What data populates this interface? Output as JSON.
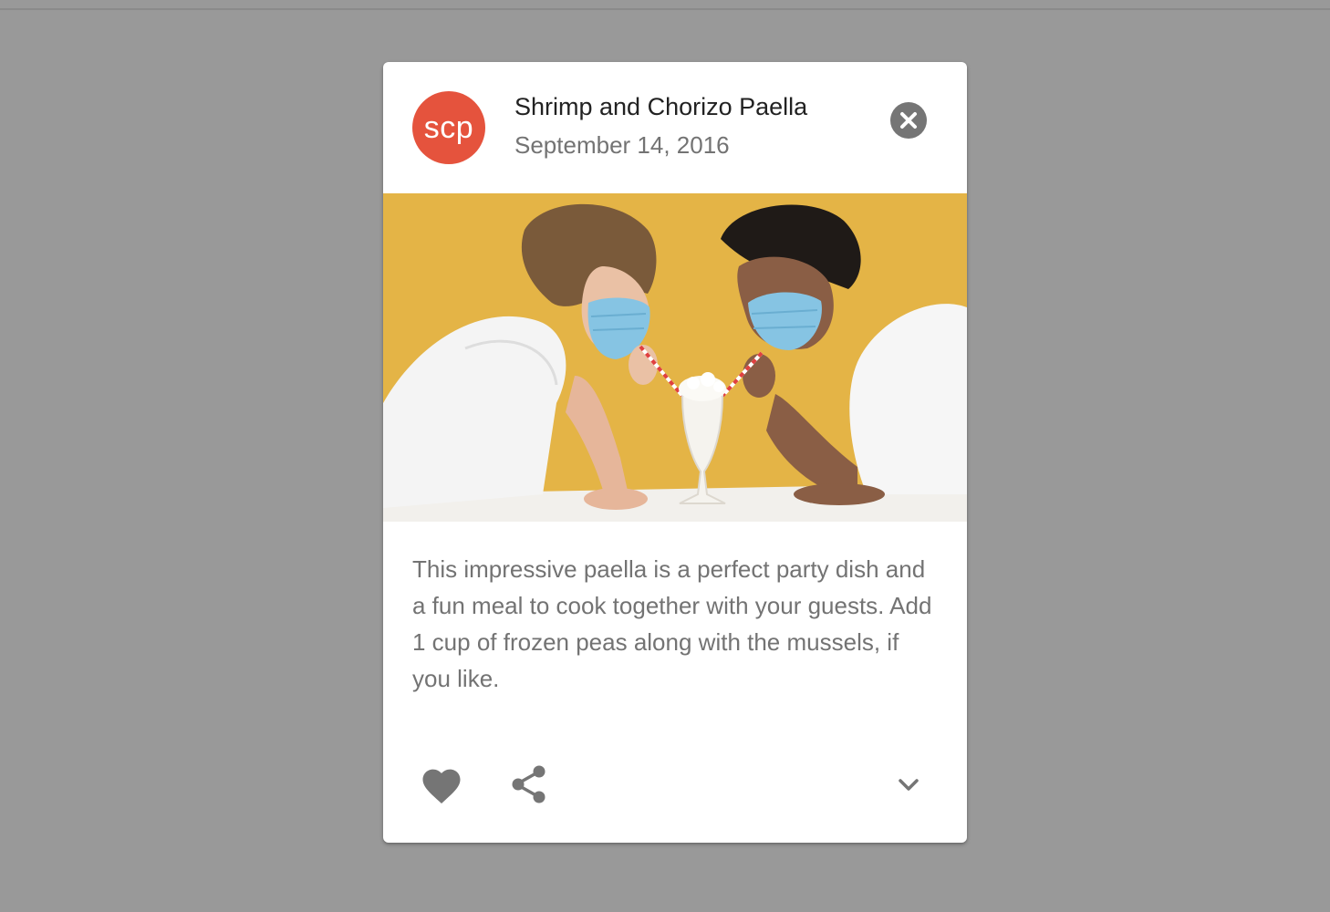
{
  "card": {
    "avatar_initials": "scp",
    "avatar_color": "#e5533d",
    "title": "Shrimp and Chorizo Paella",
    "date": "September 14, 2016",
    "close_icon": "close-circle-icon",
    "media_description_icon": "photo",
    "body": "This impressive paella is a perfect party dish and a fun meal to cook together with your guests. Add 1 cup of frozen peas along with the mussels, if you like.",
    "actions": {
      "favorite_icon": "heart-icon",
      "share_icon": "share-icon",
      "expand_icon": "chevron-down-icon"
    }
  },
  "colors": {
    "backdrop": "#999999",
    "card": "#ffffff",
    "icon": "#757575",
    "media_background": "#e9b84a"
  }
}
